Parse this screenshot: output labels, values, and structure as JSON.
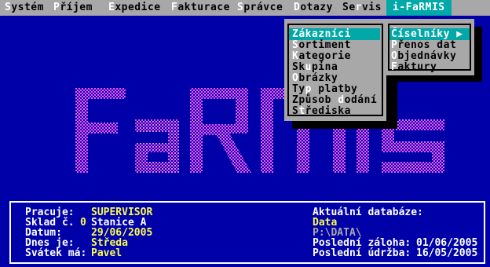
{
  "menu": {
    "items": [
      {
        "hk": "S",
        "rest": "ystém"
      },
      {
        "hk": "P",
        "rest": "říjem"
      },
      {
        "hk": "E",
        "rest": "xpedice"
      },
      {
        "hk": "F",
        "rest": "akturace"
      },
      {
        "hk": "S",
        "rest": "právce"
      },
      {
        "hk": "D",
        "rest": "otazy"
      },
      {
        "pre": "Se",
        "hk": "r",
        "rest": "vis"
      },
      {
        "label": "i-FaRMIS"
      }
    ]
  },
  "logo_text": "FaRMIS",
  "dotazy_menu": [
    {
      "hk": "Z",
      "rest": "ákazníci"
    },
    {
      "hk": "S",
      "rest": "ortiment"
    },
    {
      "hk": "K",
      "rest": "ategorie"
    },
    {
      "pre": "Sk",
      "hk": "u",
      "rest": "pina"
    },
    {
      "hk": "O",
      "rest": "brázky"
    },
    {
      "pre": "Ty",
      "hk": "p",
      "rest": " platby"
    },
    {
      "pre": "Způsob ",
      "hk": "d",
      "rest": "odání"
    },
    {
      "pre": "S",
      "hk": "t",
      "rest": "řediska"
    }
  ],
  "servis_menu": [
    {
      "hk": "Č",
      "rest": "íselníky ▶"
    },
    {
      "hk": "P",
      "rest": "řenos dat"
    },
    {
      "hk": "O",
      "rest": "bjednávky"
    },
    {
      "hk": "F",
      "rest": "aktury"
    }
  ],
  "status": {
    "user_label": "Pracuje:",
    "user": "SUPERVISOR",
    "store_label": "Sklad č.",
    "store_no": "0",
    "store": "Stanice A",
    "date_label": "Datum:",
    "date": "29/06/2005",
    "today_label": "Dnes je:",
    "today": "Středa",
    "nameday_label": "Svátek má:",
    "nameday": "Pavel",
    "db_label": "Aktuální databáze:",
    "db_name": "Data",
    "db_path": "P:\\DATA\\",
    "backup_label": "Poslední záloha:",
    "backup": "01/06/2005",
    "maint_label": "Poslední údržba:",
    "maint": "16/05/2005"
  },
  "colors": {
    "background": "#0000a8",
    "menubar": "#a8a8a8",
    "highlight": "#00a8a8",
    "logo_pink": "#fc54fc",
    "value_yellow": "#fcfc54"
  }
}
